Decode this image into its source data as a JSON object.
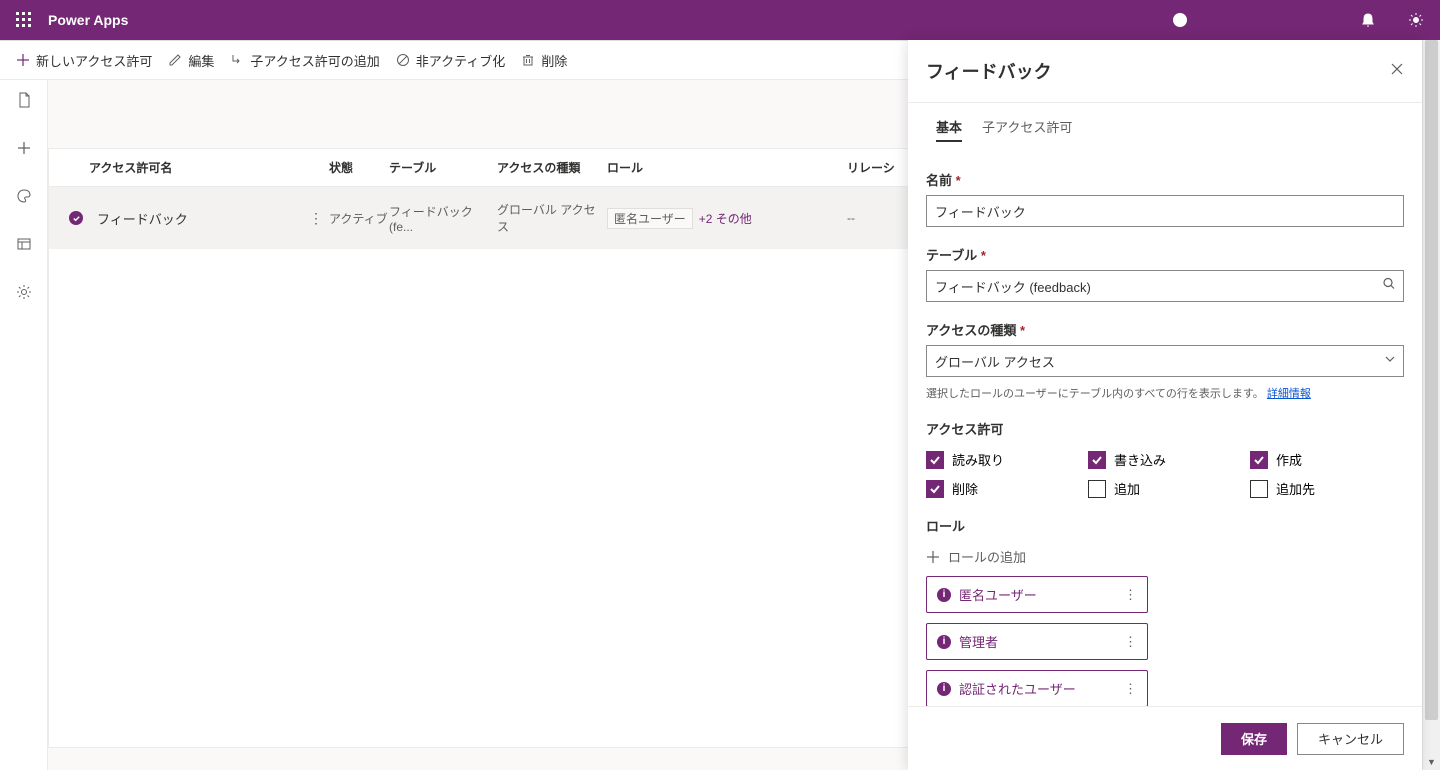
{
  "header": {
    "app_title": "Power Apps"
  },
  "toolbar": {
    "new": "新しいアクセス許可",
    "edit": "編集",
    "add_child": "子アクセス許可の追加",
    "deactivate": "非アクティブ化",
    "delete": "削除"
  },
  "table": {
    "headers": {
      "name": "アクセス許可名",
      "state": "状態",
      "table": "テーブル",
      "access": "アクセスの種類",
      "role": "ロール",
      "relation": "リレーシ"
    },
    "row": {
      "name": "フィードバック",
      "state": "アクティブ",
      "table": "フィードバック (fe...",
      "access": "グローバル アクセス",
      "role_chip": "匿名ユーザー",
      "role_more": "+2 その他",
      "relation": "--"
    }
  },
  "panel": {
    "title": "フィードバック",
    "tabs": {
      "basic": "基本",
      "child": "子アクセス許可"
    },
    "fields": {
      "name_label": "名前",
      "name_value": "フィードバック",
      "table_label": "テーブル",
      "table_value": "フィードバック (feedback)",
      "access_label": "アクセスの種類",
      "access_value": "グローバル アクセス",
      "access_help": "選択したロールのユーザーにテーブル内のすべての行を表示します。",
      "access_help_link": "詳細情報",
      "perm_label": "アクセス許可",
      "perms": {
        "read": {
          "label": "読み取り",
          "checked": true
        },
        "write": {
          "label": "書き込み",
          "checked": true
        },
        "create": {
          "label": "作成",
          "checked": true
        },
        "delete": {
          "label": "削除",
          "checked": true
        },
        "append": {
          "label": "追加",
          "checked": false
        },
        "appendto": {
          "label": "追加先",
          "checked": false
        }
      },
      "role_label": "ロール",
      "add_role": "ロールの追加",
      "roles": [
        "匿名ユーザー",
        "管理者",
        "認証されたユーザー"
      ]
    },
    "footer": {
      "save": "保存",
      "cancel": "キャンセル"
    }
  }
}
